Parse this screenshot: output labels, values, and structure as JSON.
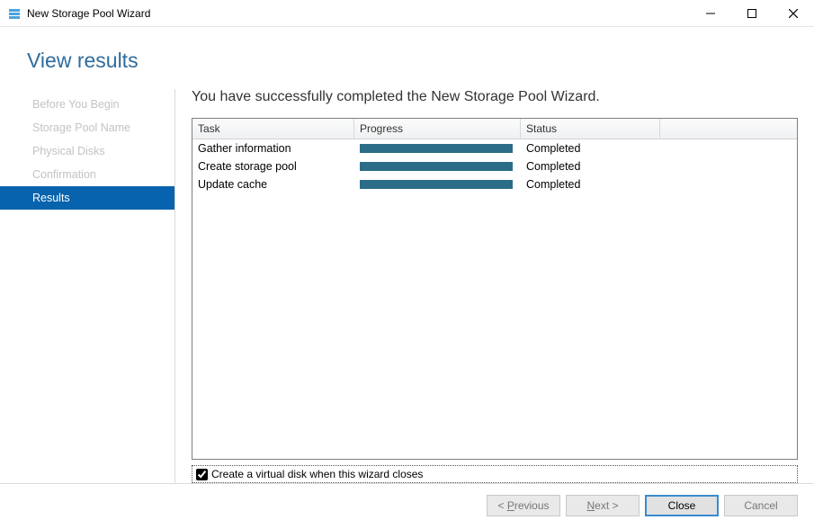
{
  "window": {
    "title": "New Storage Pool Wizard"
  },
  "heading": "View results",
  "sidebar": {
    "items": [
      {
        "label": "Before You Begin"
      },
      {
        "label": "Storage Pool Name"
      },
      {
        "label": "Physical Disks"
      },
      {
        "label": "Confirmation"
      },
      {
        "label": "Results"
      }
    ]
  },
  "main": {
    "title": "You have successfully completed the New Storage Pool Wizard.",
    "columns": {
      "task": "Task",
      "progress": "Progress",
      "status": "Status"
    },
    "rows": [
      {
        "task": "Gather information",
        "status": "Completed"
      },
      {
        "task": "Create storage pool",
        "status": "Completed"
      },
      {
        "task": "Update cache",
        "status": "Completed"
      }
    ],
    "checkbox_label": "Create a virtual disk when this wizard closes",
    "checkbox_checked": true
  },
  "footer": {
    "previous_prefix": "< ",
    "previous": "Previous",
    "previous_accel": "P",
    "next": "Next",
    "next_accel": "N",
    "next_suffix": " >",
    "close": "Close",
    "cancel": "Cancel"
  }
}
